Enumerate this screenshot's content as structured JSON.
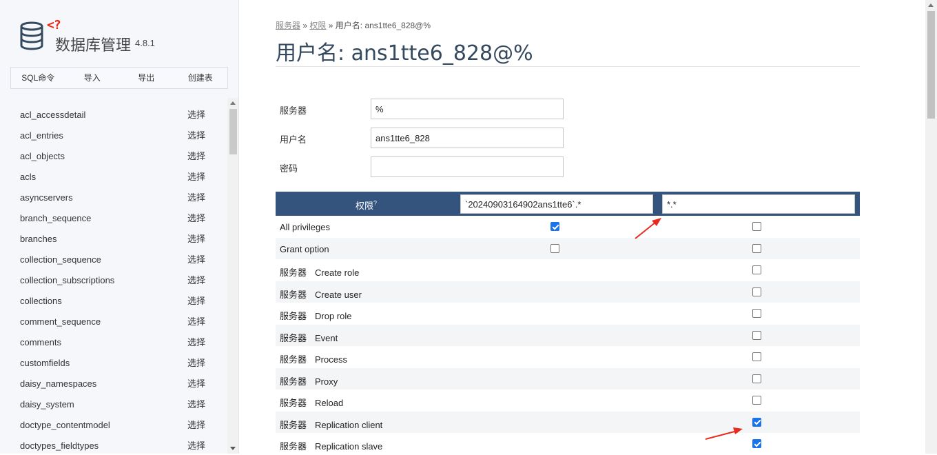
{
  "app": {
    "logo_tag": "<?",
    "title": "数据库管理",
    "version": "4.8.1"
  },
  "menu": [
    "SQL命令",
    "导入",
    "导出",
    "创建表"
  ],
  "tables": [
    {
      "name": "acl_accessdetail",
      "action": "选择"
    },
    {
      "name": "acl_entries",
      "action": "选择"
    },
    {
      "name": "acl_objects",
      "action": "选择"
    },
    {
      "name": "acls",
      "action": "选择"
    },
    {
      "name": "asyncservers",
      "action": "选择"
    },
    {
      "name": "branch_sequence",
      "action": "选择"
    },
    {
      "name": "branches",
      "action": "选择"
    },
    {
      "name": "collection_sequence",
      "action": "选择"
    },
    {
      "name": "collection_subscriptions",
      "action": "选择"
    },
    {
      "name": "collections",
      "action": "选择"
    },
    {
      "name": "comment_sequence",
      "action": "选择"
    },
    {
      "name": "comments",
      "action": "选择"
    },
    {
      "name": "customfields",
      "action": "选择"
    },
    {
      "name": "daisy_namespaces",
      "action": "选择"
    },
    {
      "name": "daisy_system",
      "action": "选择"
    },
    {
      "name": "doctype_contentmodel",
      "action": "选择"
    },
    {
      "name": "doctypes_fieldtypes",
      "action": "选择"
    }
  ],
  "breadcrumb": {
    "server": "服务器",
    "sep1": "»",
    "privileges": "权限",
    "sep2": "»",
    "current": "用户名: ans1tte6_828@%"
  },
  "page_title": "用户名: ans1tte6_828@%",
  "form": {
    "server_label": "服务器",
    "server_value": "%",
    "username_label": "用户名",
    "username_value": "ans1tte6_828",
    "password_label": "密码",
    "password_value": ""
  },
  "privileges": {
    "header_label": "权限",
    "header_help": "?",
    "col1_value": "`20240903164902ans1tte6`.*",
    "col2_value": "*.*",
    "rows": [
      {
        "category": "",
        "name": "All privileges",
        "col1": true,
        "col2": false,
        "has_col1": true
      },
      {
        "category": "",
        "name": "Grant option",
        "col1": false,
        "col2": false,
        "has_col1": true
      },
      {
        "category": "服务器",
        "name": "Create role",
        "col2": false,
        "has_col1": false
      },
      {
        "category": "服务器",
        "name": "Create user",
        "col2": false,
        "has_col1": false
      },
      {
        "category": "服务器",
        "name": "Drop role",
        "col2": false,
        "has_col1": false
      },
      {
        "category": "服务器",
        "name": "Event",
        "col2": false,
        "has_col1": false
      },
      {
        "category": "服务器",
        "name": "Process",
        "col2": false,
        "has_col1": false
      },
      {
        "category": "服务器",
        "name": "Proxy",
        "col2": false,
        "has_col1": false
      },
      {
        "category": "服务器",
        "name": "Reload",
        "col2": false,
        "has_col1": false
      },
      {
        "category": "服务器",
        "name": "Replication client",
        "col2": true,
        "has_col1": false
      },
      {
        "category": "服务器",
        "name": "Replication slave",
        "col2": true,
        "has_col1": false
      }
    ]
  },
  "colors": {
    "header_bg": "#34547e",
    "title": "#34495e",
    "checkbox_on": "#1a73e8",
    "annotation_arrow": "#e8291c"
  }
}
